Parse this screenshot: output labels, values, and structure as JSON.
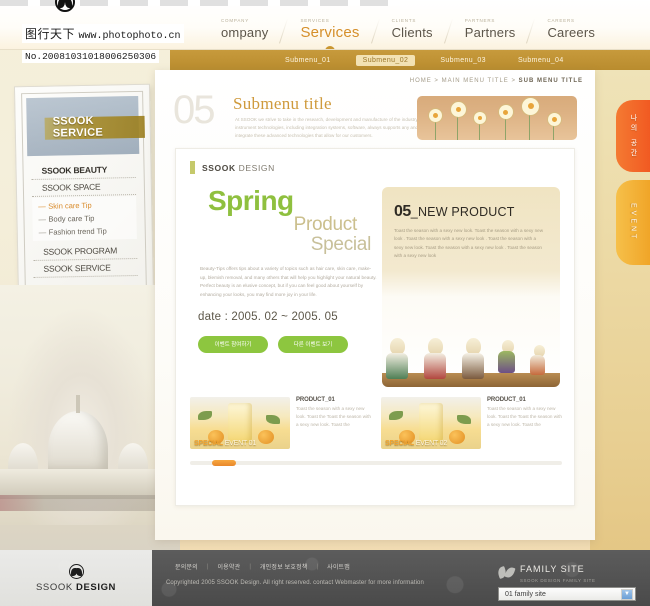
{
  "watermark": {
    "brand": "图行天下",
    "url": "www.photophoto.cn",
    "id": "No.20081031018006250306",
    "butterfly_icon": "butterfly-icon"
  },
  "topnav": {
    "items": [
      {
        "kicker": "COMPANY",
        "label": "ompany",
        "active": false
      },
      {
        "kicker": "SERVICES",
        "label": "Services",
        "active": true
      },
      {
        "kicker": "CLIENTS",
        "label": "Clients",
        "active": false
      },
      {
        "kicker": "PARTNERS",
        "label": "Partners",
        "active": false
      },
      {
        "kicker": "CAREERS",
        "label": "Careers",
        "active": false
      }
    ]
  },
  "submenu": {
    "items": [
      {
        "label": "Submenu_01",
        "active": false
      },
      {
        "label": "Submenu_02",
        "active": true
      },
      {
        "label": "Submenu_03",
        "active": false
      },
      {
        "label": "Submenu_04",
        "active": false
      }
    ]
  },
  "left_menu": {
    "hero_title": "SSOOK SERVICE",
    "items": [
      {
        "label": "SSOOK BEAUTY",
        "bold": true
      },
      {
        "label": "SSOOK SPACE",
        "bold": false
      }
    ],
    "sub_items": [
      {
        "label": "Skin care Tip",
        "selected": true
      },
      {
        "label": "Body care Tip",
        "selected": false
      },
      {
        "label": "Fashion trend Tip",
        "selected": false
      }
    ],
    "items_bottom": [
      {
        "label": "SSOOK PROGRAM",
        "bold": false
      },
      {
        "label": "SSOOK SERVICE",
        "bold": false
      }
    ]
  },
  "breadcrumb": {
    "home": "HOME",
    "sep1": " > ",
    "main": "MAIN MENU TITLE",
    "sep2": " > ",
    "current": "SUB MENU TITLE"
  },
  "page_header": {
    "number": "05",
    "title": "Submenu title",
    "description": "At SSOOK we strive to take in the research, development and manufacture of the industry's most advanced instrument technologies, including integration systems, software, always supports any and all components. We integrate these advanced technologies that allow for our customers."
  },
  "card": {
    "brand_bold": "SSOOK",
    "brand_light": "DESIGN",
    "heading": {
      "line1": "Spring",
      "line2": "Product",
      "line3": "Special"
    },
    "body": "Beauty-Tips offers tips about a variety of topics such as hair care, skin care, make-up, blemish removal, and many others that will help you highlight your natural beauty. Perfect beauty is an elusive concept, but if you can feel good about yourself by enhancing your looks, you may find more joy in your life.",
    "date": "date : 2005. 02 ~ 2005. 05",
    "buttons": [
      {
        "label": "이벤트 참여하기"
      },
      {
        "label": "다른 이벤트 보기"
      }
    ],
    "new_product": {
      "number": "05",
      "separator": "_",
      "name": "NEW PRODUCT",
      "body": "Toast the season with a sexy new look. Toast the season with a sexy new look . Toast the season with a sexy new look . Toast the season with a sexy new look. Toast the season with a sexy new look . Toast the season with a sexy new look"
    },
    "products": [
      {
        "caption_bold": "SPECIAL",
        "caption_light": "EVENT 01",
        "name": "PRODUCT_01",
        "text": "Toast the season with a sexy new look. Toast the Toast the season with a sexy new look. Toast the"
      },
      {
        "caption_bold": "SPECIAL",
        "caption_light": "EVENT 02",
        "name": "PRODUCT_01",
        "text": "Toast the season with a sexy new look. Toast the Toast the season with a sexy new look. Toast the"
      }
    ]
  },
  "side_tabs": [
    {
      "label": "나의 공간",
      "color": "#f15a22"
    },
    {
      "label": "EVENT",
      "color": "#f0a528"
    }
  ],
  "footer": {
    "logo_light": "SSOOK ",
    "logo_bold": "DESIGN",
    "butterfly_icon": "butterfly-icon",
    "links": [
      "문의문의",
      "이용약관",
      "개인정보 보호정책",
      "사이트맵"
    ],
    "separator": "|",
    "copyright": "Copyrighted 2005 SSOOK Design. All right reserved. contact Webmaster for more information",
    "family": {
      "title": "FAMILY SITE",
      "subtitle": "SSOOK DESIGN FAMILY SITE",
      "sprout_icon": "sprout-icon",
      "selected": "01 family site",
      "arrow_icon": "chevron-down-icon"
    }
  },
  "colors": {
    "accent_orange": "#d58f2a",
    "accent_green": "#8fc03f",
    "submenu_bar": "#c79a3c",
    "tab_orange": "#f15a22",
    "tab_yellow": "#f0a528"
  }
}
